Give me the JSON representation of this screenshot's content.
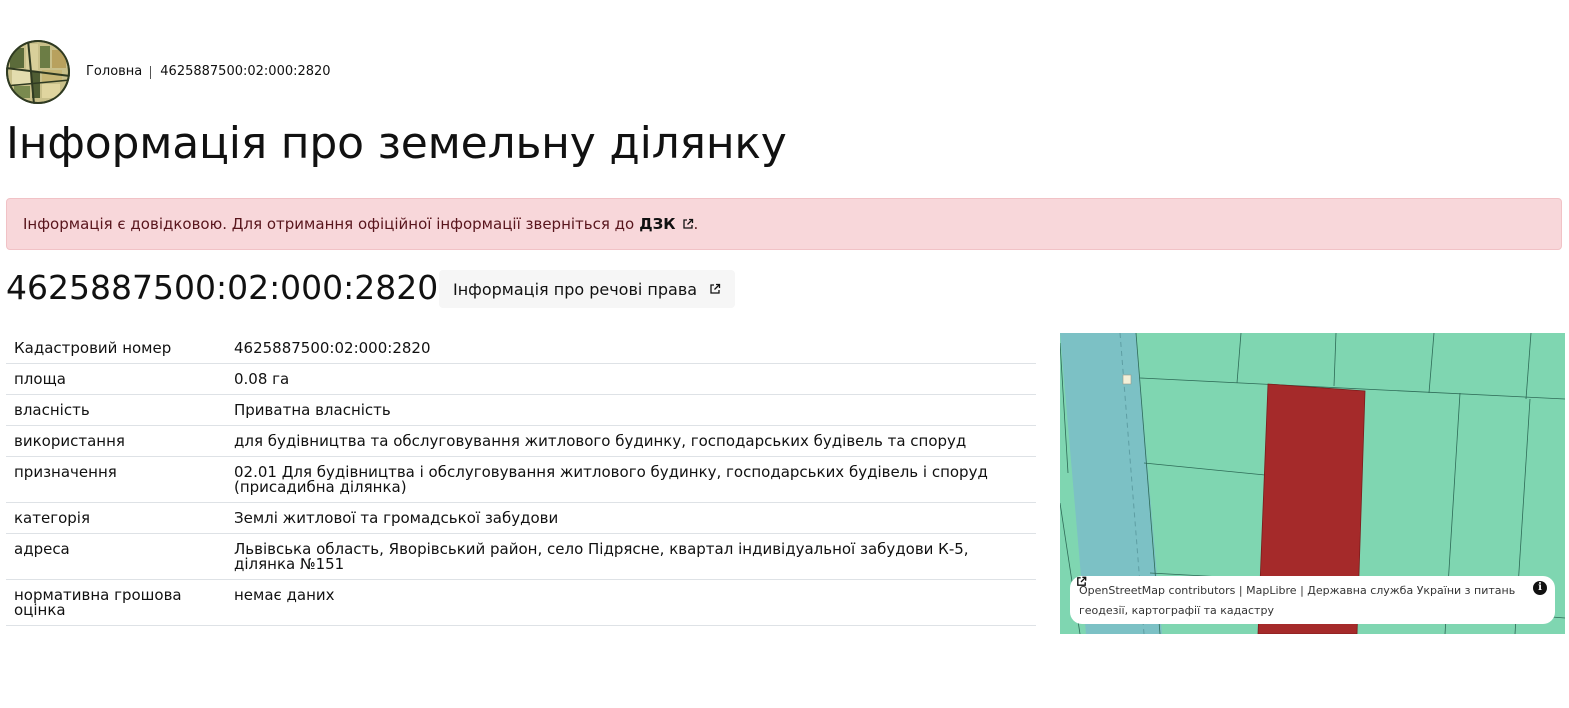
{
  "breadcrumb": {
    "home": "Головна",
    "current": "4625887500:02:000:2820"
  },
  "page_title": "Інформація про земельну ділянку",
  "alert": {
    "text": "Інформація є довідковою. Для отримання офіційної інформації зверніться до",
    "link": "ДЗК",
    "link_icon": "external-link-icon",
    "suffix": "."
  },
  "parcel": {
    "cadastral_number": "4625887500:02:000:2820",
    "rights_button": "Інформація про речові права",
    "rights_button_icon": "external-link-icon"
  },
  "info_rows": [
    {
      "key": "Кадастровий номер",
      "value": "4625887500:02:000:2820"
    },
    {
      "key": "площа",
      "value": "0.08 га"
    },
    {
      "key": "власність",
      "value": "Приватна власність"
    },
    {
      "key": "використання",
      "value": "для будівництва та обслуговування житлового будинку, господарських будівель та споруд"
    },
    {
      "key": "призначення",
      "value": "02.01 Для будівництва і обслуговування житлового будинку, господарських будівель і споруд (присадибна ділянка)"
    },
    {
      "key": "категорія",
      "value": "Землі житлової та громадської забудови"
    },
    {
      "key": "адреса",
      "value": "Львівська область, Яворівський район, село Підрясне, квартал індивідуальної забудови К-5, ділянка №151"
    },
    {
      "key": "нормативна грошова оцінка",
      "value": "немає даних"
    }
  ],
  "map": {
    "colors": {
      "parcels": "#7fd6b1",
      "road": "#7cc1c5",
      "selected_parcel": "#a52a2a",
      "alert_bg": "#f8d7da"
    },
    "attribution": {
      "osm": "OpenStreetMap contributors",
      "maplibre": "MapLibre",
      "agency": "Державна служба України з питань геодезії, картографії та кадастру",
      "info_icon": "info-icon"
    }
  }
}
